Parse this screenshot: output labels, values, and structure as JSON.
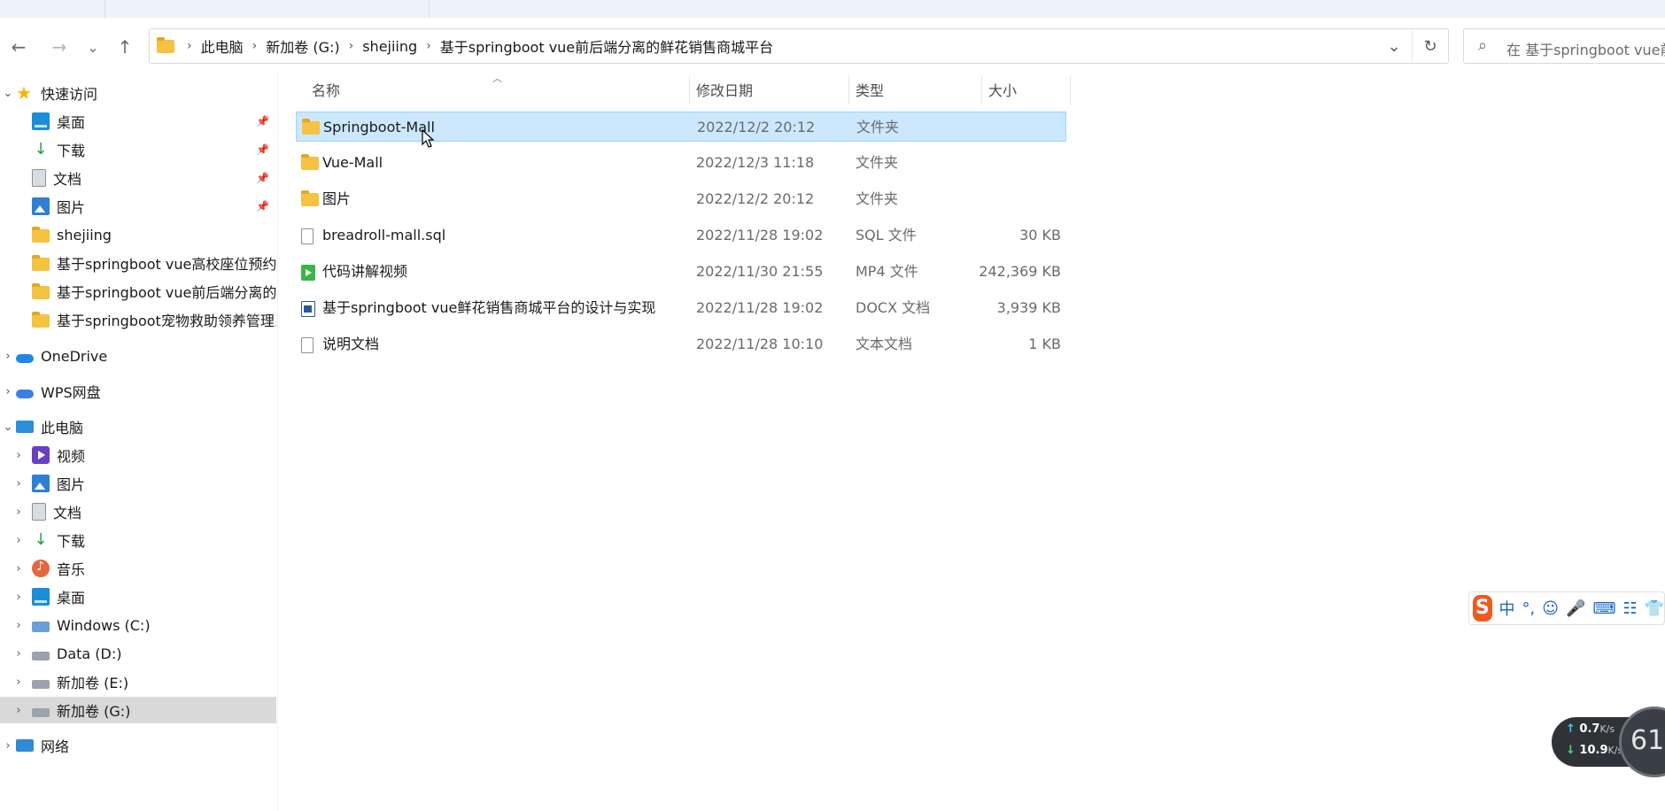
{
  "nav": {
    "back": "←",
    "forward": "→",
    "recent": "⌄",
    "up": "↑"
  },
  "address": {
    "crumbs": [
      "此电脑",
      "新加卷 (G:)",
      "shejiing",
      "基于springboot vue前后端分离的鲜花销售商城平台"
    ],
    "refresh": "↻",
    "dropdown": "⌄"
  },
  "search": {
    "placeholder": "在 基于springboot vue前..."
  },
  "sidebar": {
    "quick_access": "快速访问",
    "quick_items": [
      "桌面",
      "下载",
      "文档",
      "图片",
      "shejiing",
      "基于springboot vue高校座位预约系统",
      "基于springboot vue前后端分离的农",
      "基于springboot宠物救助领养管理系统"
    ],
    "onedrive": "OneDrive",
    "wps": "WPS网盘",
    "this_pc": "此电脑",
    "pc_items": [
      "视频",
      "图片",
      "文档",
      "下载",
      "音乐",
      "桌面",
      "Windows (C:)",
      "Data (D:)",
      "新加卷 (E:)",
      "新加卷 (G:)"
    ],
    "network": "网络"
  },
  "columns": {
    "name": "名称",
    "date": "修改日期",
    "type": "类型",
    "size": "大小"
  },
  "files": [
    {
      "name": "Springboot-Mall",
      "date": "2022/12/2 20:12",
      "type": "文件夹",
      "size": ""
    },
    {
      "name": "Vue-Mall",
      "date": "2022/12/3 11:18",
      "type": "文件夹",
      "size": ""
    },
    {
      "name": "图片",
      "date": "2022/12/2 20:12",
      "type": "文件夹",
      "size": ""
    },
    {
      "name": "breadroll-mall.sql",
      "date": "2022/11/28 19:02",
      "type": "SQL 文件",
      "size": "30 KB"
    },
    {
      "name": "代码讲解视频",
      "date": "2022/11/30 21:55",
      "type": "MP4 文件",
      "size": "242,369 KB"
    },
    {
      "name": "基于springboot vue鲜花销售商城平台的设计与实现",
      "date": "2022/11/28 19:02",
      "type": "DOCX 文档",
      "size": "3,939 KB"
    },
    {
      "name": "说明文档",
      "date": "2022/11/28 10:10",
      "type": "文本文档",
      "size": "1 KB"
    }
  ],
  "ime": {
    "logo": "S",
    "lang": "中",
    "punct": "°,"
  },
  "netspeed": {
    "up_value": "0.7",
    "up_unit": "K/s",
    "down_value": "10.9",
    "down_unit": "K/s",
    "gauge": "61"
  }
}
